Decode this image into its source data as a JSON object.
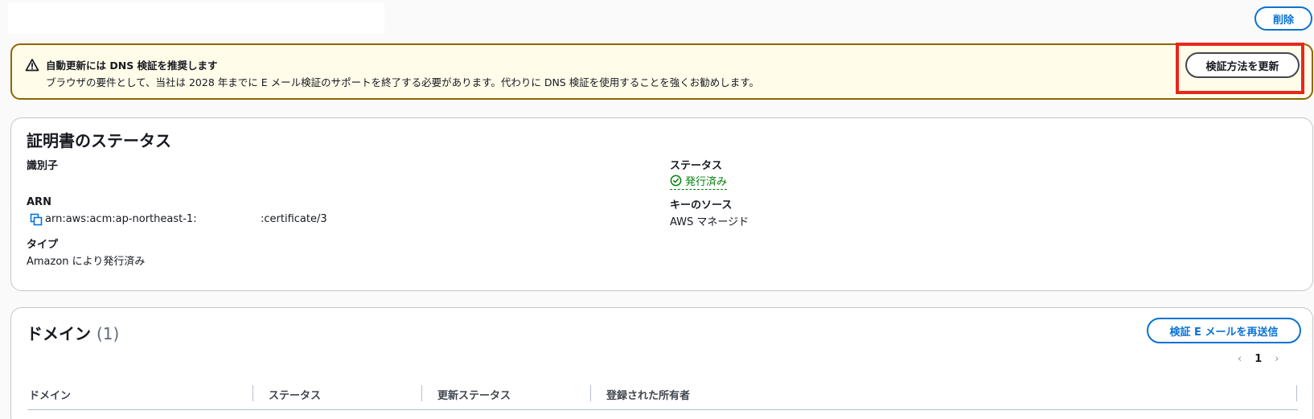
{
  "top": {
    "delete_label": "削除"
  },
  "alert": {
    "title": "自動更新には DNS 検証を推奨します",
    "body": "ブラウザの要件として、当社は 2028 年までに E メール検証のサポートを終了する必要があります。代わりに DNS 検証を使用することを強くお勧めします。",
    "button_label": "検証方法を更新",
    "icon": "warning-icon"
  },
  "status_card": {
    "title": "証明書のステータス",
    "identifier_label": "識別子",
    "identifier_value": "",
    "status_label": "ステータス",
    "status_value": "発行済み",
    "arn_label": "ARN",
    "arn_prefix": "arn:aws:acm:ap-northeast-1:",
    "arn_suffix": ":certificate/3",
    "key_source_label": "キーのソース",
    "key_source_value": "AWS マネージド",
    "type_label": "タイプ",
    "type_value": "Amazon により発行済み"
  },
  "domain_card": {
    "title": "ドメイン",
    "count": "(1)",
    "resend_label": "検証 E メールを再送信",
    "pager": {
      "prev": "‹",
      "page": "1",
      "next": "›"
    },
    "columns": [
      "ドメイン",
      "ステータス",
      "更新ステータス",
      "登録された所有者"
    ]
  },
  "colors": {
    "accent": "#0972d3",
    "success": "#037f0c",
    "warning_border": "#8d6605",
    "warning_bg": "#fffce9",
    "highlight": "#e8271c"
  }
}
